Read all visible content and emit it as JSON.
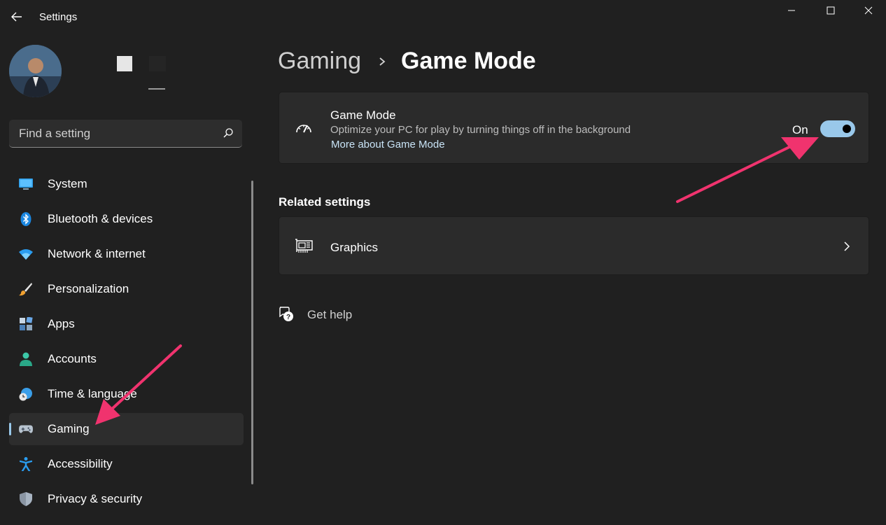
{
  "app": {
    "title": "Settings"
  },
  "search": {
    "placeholder": "Find a setting"
  },
  "nav": {
    "items": [
      {
        "label": "System",
        "icon": "monitor-icon"
      },
      {
        "label": "Bluetooth & devices",
        "icon": "bluetooth-icon"
      },
      {
        "label": "Network & internet",
        "icon": "wifi-icon"
      },
      {
        "label": "Personalization",
        "icon": "brush-icon"
      },
      {
        "label": "Apps",
        "icon": "apps-icon"
      },
      {
        "label": "Accounts",
        "icon": "person-icon"
      },
      {
        "label": "Time & language",
        "icon": "globe-clock-icon"
      },
      {
        "label": "Gaming",
        "icon": "gamepad-icon",
        "selected": true
      },
      {
        "label": "Accessibility",
        "icon": "accessibility-icon"
      },
      {
        "label": "Privacy & security",
        "icon": "shield-icon"
      }
    ]
  },
  "breadcrumb": {
    "parent": "Gaming",
    "current": "Game Mode"
  },
  "game_mode": {
    "title": "Game Mode",
    "description": "Optimize your PC for play by turning things off in the background",
    "link": "More about Game Mode",
    "toggle_state": "On",
    "toggle_on": true,
    "icon": "speedometer-icon"
  },
  "related": {
    "heading": "Related settings",
    "graphics_label": "Graphics",
    "graphics_icon": "graphics-card-icon"
  },
  "help": {
    "label": "Get help",
    "icon": "help-chat-icon"
  },
  "colors": {
    "accent": "#99c8ea",
    "annotation_arrow": "#f0336e",
    "background": "#202020",
    "card": "#2b2b2b"
  }
}
